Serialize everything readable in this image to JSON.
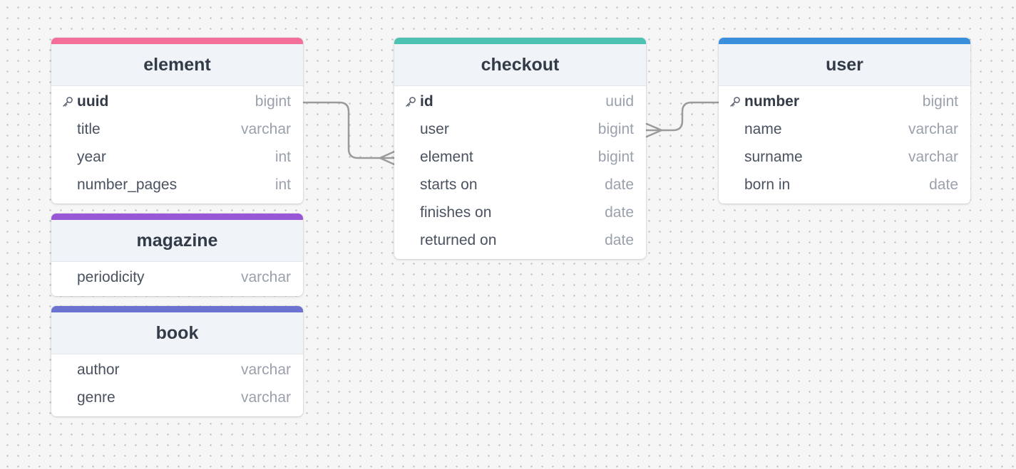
{
  "colors": {
    "element": "#f36e98",
    "checkout": "#4cc3b2",
    "user": "#3a8fdc",
    "magazine": "#9757d6",
    "book": "#6b72d0",
    "connector": "#9b9b9b"
  },
  "tables": {
    "element": {
      "title": "element",
      "fields": [
        {
          "name": "uuid",
          "type": "bigint",
          "primary_key": true
        },
        {
          "name": "title",
          "type": "varchar"
        },
        {
          "name": "year",
          "type": "int"
        },
        {
          "name": "number_pages",
          "type": "int"
        }
      ]
    },
    "magazine": {
      "title": "magazine",
      "fields": [
        {
          "name": "periodicity",
          "type": "varchar"
        }
      ]
    },
    "book": {
      "title": "book",
      "fields": [
        {
          "name": "author",
          "type": "varchar"
        },
        {
          "name": "genre",
          "type": "varchar"
        }
      ]
    },
    "checkout": {
      "title": "checkout",
      "fields": [
        {
          "name": "id",
          "type": "uuid",
          "primary_key": true
        },
        {
          "name": "user",
          "type": "bigint"
        },
        {
          "name": "element",
          "type": "bigint"
        },
        {
          "name": "starts on",
          "type": "date"
        },
        {
          "name": "finishes on",
          "type": "date"
        },
        {
          "name": "returned on",
          "type": "date"
        }
      ]
    },
    "user": {
      "title": "user",
      "fields": [
        {
          "name": "number",
          "type": "bigint",
          "primary_key": true
        },
        {
          "name": "name",
          "type": "varchar"
        },
        {
          "name": "surname",
          "type": "varchar"
        },
        {
          "name": "born in",
          "type": "date"
        }
      ]
    }
  },
  "relationships": [
    {
      "from": "element.uuid",
      "to": "checkout.element",
      "cardinality": "one-to-many"
    },
    {
      "from": "user.number",
      "to": "checkout.user",
      "cardinality": "one-to-many"
    }
  ],
  "icons": {
    "primary_key": "key-icon"
  }
}
